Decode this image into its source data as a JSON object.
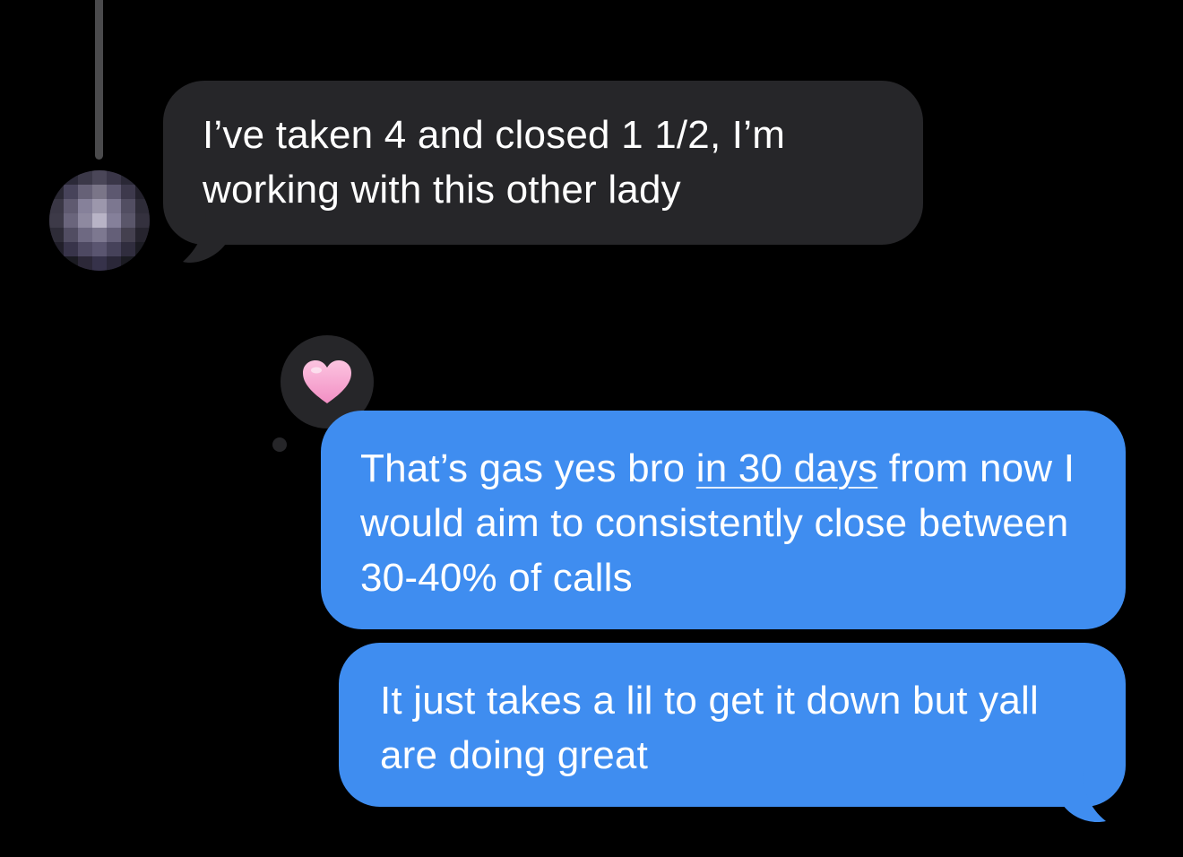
{
  "thread": {
    "incoming": {
      "text": "I’ve taken 4 and closed 1 1/2, I’m working with this other lady"
    },
    "reaction": {
      "icon": "pink-heart-icon",
      "color": "#f9a8d4"
    },
    "outgoing": [
      {
        "text_before": "That’s gas yes bro ",
        "link_text": "in 30 days",
        "text_after": " from now I would aim to consistently close between 30-40% of calls"
      },
      {
        "text": "It just takes a lil to get it down but yall are doing great"
      }
    ]
  },
  "colors": {
    "background": "#000000",
    "incoming_bubble": "#262629",
    "outgoing_bubble": "#3f8df0",
    "text": "#ffffff"
  }
}
